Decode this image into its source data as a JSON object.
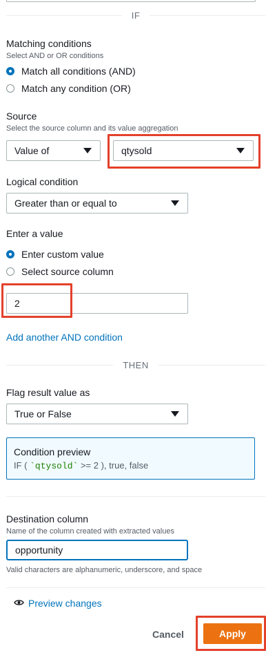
{
  "if_label": "IF",
  "then_label": "THEN",
  "matching": {
    "title": "Matching conditions",
    "description": "Select AND or OR conditions",
    "option_and": "Match all conditions (AND)",
    "option_or": "Match any condition (OR)"
  },
  "source": {
    "title": "Source",
    "description": "Select the source column and its value aggregation",
    "aggregation": "Value of",
    "column": "qtysold"
  },
  "logical": {
    "title": "Logical condition",
    "value": "Greater than or equal to"
  },
  "enter_value": {
    "title": "Enter a value",
    "option_custom": "Enter custom value",
    "option_source": "Select source column",
    "value": "2"
  },
  "add_and_condition": "Add another AND condition",
  "flag": {
    "title": "Flag result value as",
    "value": "True or False"
  },
  "condition_preview": {
    "title": "Condition preview",
    "prefix": "IF (",
    "column": "`qtysold`",
    "suffix": ">= 2 ), true, false"
  },
  "destination": {
    "title": "Destination column",
    "description": "Name of the column created with extracted values",
    "value": "opportunity",
    "hint": "Valid characters are alphanumeric, underscore, and space"
  },
  "preview_changes": "Preview changes",
  "buttons": {
    "cancel": "Cancel",
    "apply": "Apply"
  },
  "colors": {
    "accent": "#0073bb",
    "highlight": "#e3412b",
    "apply": "#ec7211",
    "code_green": "#1d8102"
  }
}
